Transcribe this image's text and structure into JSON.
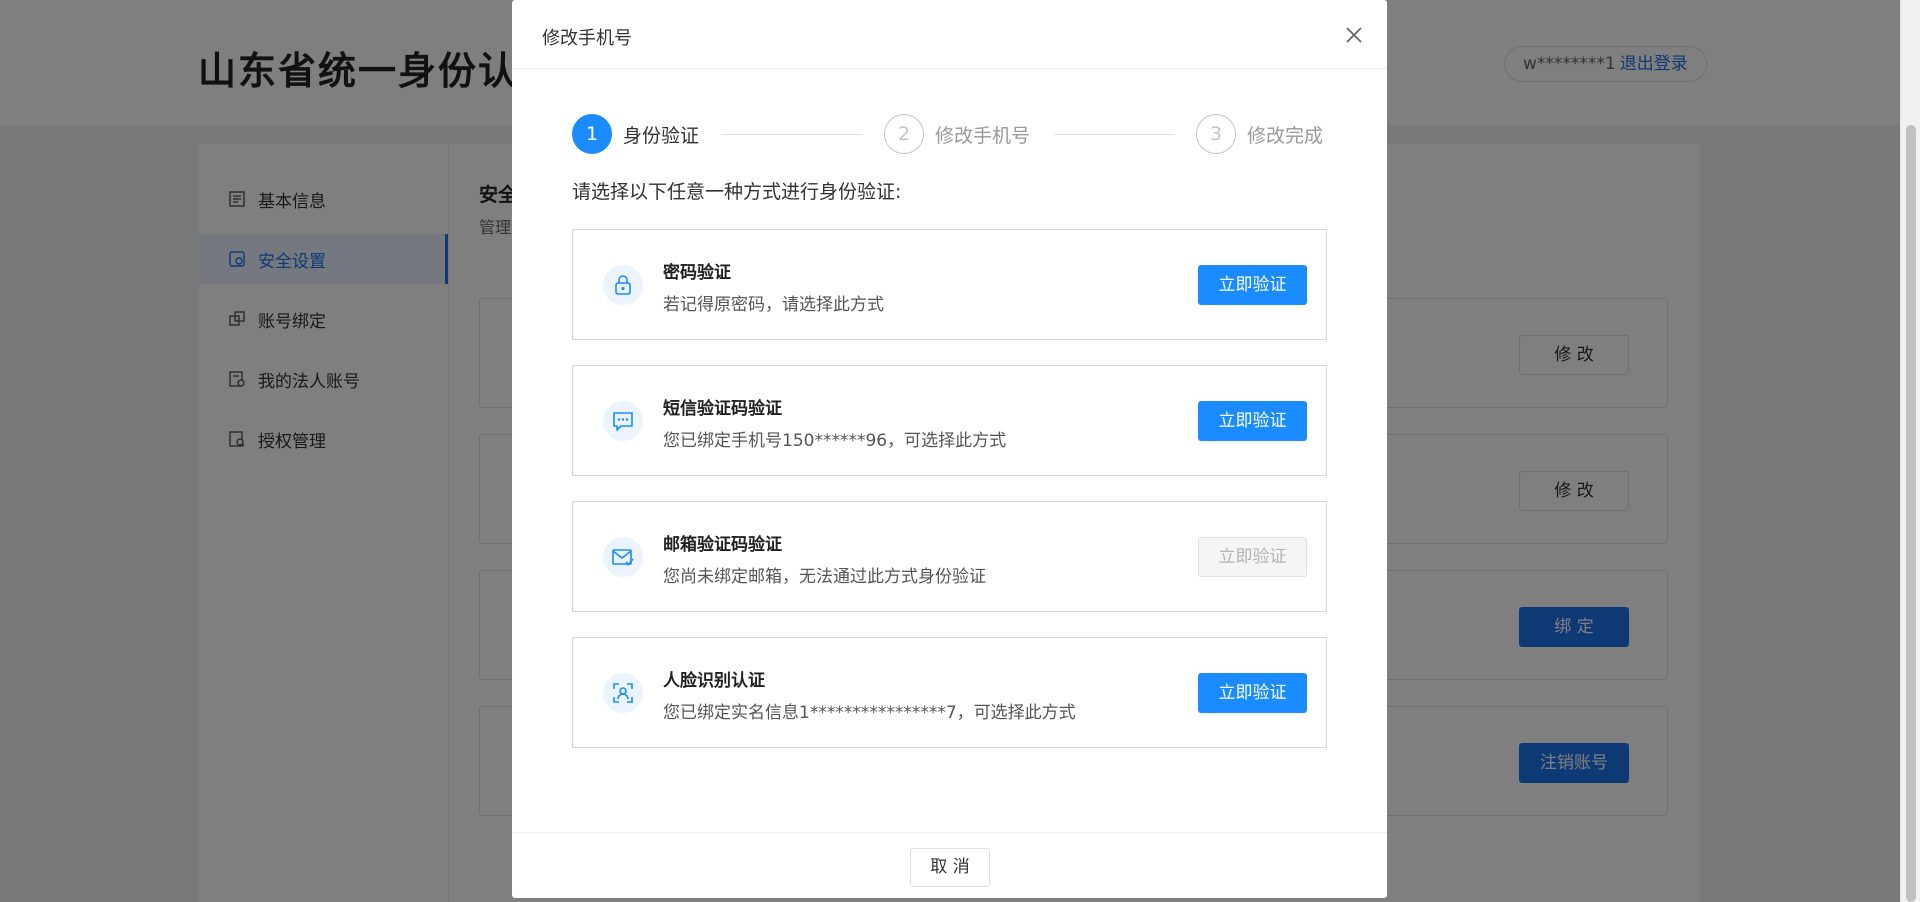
{
  "site": {
    "title": "山东省统一身份认证"
  },
  "user": {
    "masked_name": "w********1",
    "logout_label": "退出登录"
  },
  "sidebar": {
    "items": [
      {
        "label": "基本信息",
        "icon": "document-icon",
        "active": false
      },
      {
        "label": "安全设置",
        "icon": "shield-icon",
        "active": true
      },
      {
        "label": "账号绑定",
        "icon": "link-icon",
        "active": false
      },
      {
        "label": "我的法人账号",
        "icon": "building-icon",
        "active": false
      },
      {
        "label": "授权管理",
        "icon": "key-icon",
        "active": false
      }
    ]
  },
  "security_section": {
    "title": "安全",
    "subtitle": "管理",
    "cards": [
      {
        "button_label": "修 改",
        "primary": false
      },
      {
        "button_label": "修 改",
        "primary": false
      },
      {
        "button_label": "绑 定",
        "primary": true
      },
      {
        "button_label": "注销账号",
        "primary": true
      }
    ]
  },
  "modal": {
    "title": "修改手机号",
    "steps": [
      {
        "number": "1",
        "label": "身份验证",
        "active": true
      },
      {
        "number": "2",
        "label": "修改手机号",
        "active": false
      },
      {
        "number": "3",
        "label": "修改完成",
        "active": false
      }
    ],
    "prompt": "请选择以下任意一种方式进行身份验证:",
    "methods": [
      {
        "title": "密码验证",
        "description": "若记得原密码，请选择此方式",
        "button_label": "立即验证",
        "enabled": true,
        "icon": "lock-icon"
      },
      {
        "title": "短信验证码验证",
        "description": "您已绑定手机号150******96，可选择此方式",
        "button_label": "立即验证",
        "enabled": true,
        "icon": "message-icon"
      },
      {
        "title": "邮箱验证码验证",
        "description": "您尚未绑定邮箱，无法通过此方式身份验证",
        "button_label": "立即验证",
        "enabled": false,
        "icon": "mail-icon"
      },
      {
        "title": "人脸识别认证",
        "description": "您已绑定实名信息1****************7，可选择此方式",
        "button_label": "立即验证",
        "enabled": true,
        "icon": "face-scan-icon"
      }
    ],
    "cancel_label": "取 消"
  },
  "colors": {
    "primary": "#1a8cff",
    "nav_active": "#1a73e8",
    "overlay": "rgba(0,0,0,0.5)"
  }
}
